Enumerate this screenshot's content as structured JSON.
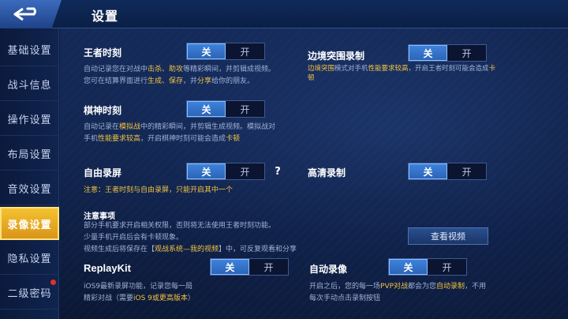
{
  "header": {
    "title": "设置"
  },
  "sidebar": {
    "items": [
      {
        "label": "基础设置"
      },
      {
        "label": "战斗信息"
      },
      {
        "label": "操作设置"
      },
      {
        "label": "布局设置"
      },
      {
        "label": "音效设置"
      },
      {
        "label": "录像设置",
        "active": true
      },
      {
        "label": "隐私设置"
      },
      {
        "label": "二级密码",
        "badge": "red-dot"
      }
    ]
  },
  "toggle_labels": {
    "off": "关",
    "on": "开"
  },
  "sections": {
    "king_moment": {
      "title": "王者时刻",
      "value": "关",
      "desc_line1_parts": [
        "自动记录您在对战中",
        "击杀、助攻",
        "等精彩瞬间，并剪辑成视频。"
      ],
      "desc_line2_parts": [
        "您可在结算界面进行",
        "生成、保存",
        "，并",
        "分享",
        "给你的朋友。"
      ]
    },
    "border_recording": {
      "title": "边境突围录制",
      "value": "关",
      "desc_line1_parts": [
        "边境突围",
        "模式对手机",
        "性能要求较高",
        "，开启王者时刻可能会造成",
        "卡"
      ],
      "desc_line2": "顿"
    },
    "chess_moment": {
      "title": "棋神时刻",
      "value": "关",
      "desc_line1_parts": [
        "自动记录在",
        "模拟战",
        "中的精彩瞬间，并剪辑生成视频。模拟战对"
      ],
      "desc_line2_parts": [
        "手机",
        "性能要求较高",
        "，开启棋神时刻可能会造成",
        "卡顿"
      ]
    },
    "free_record": {
      "title": "自由录屏",
      "value": "关",
      "help": "?",
      "note_parts": [
        "注意：王者时刻与自由录屏，",
        "只能开启其中一个"
      ]
    },
    "hd_record": {
      "title": "高清录制",
      "value": "关"
    },
    "notice": {
      "title": "注意事项",
      "line1": "部分手机要求开启相关权限，否则将无法使用王者时刻功能。",
      "line2": "少量手机开启后会有卡顿现象。",
      "line3_parts": [
        "视频生成后将保存在【",
        "观战系统—我的视频",
        "】中，可反复观看和分享"
      ],
      "button": "查看视频"
    },
    "replaykit": {
      "title": "ReplayKit",
      "value": "关",
      "line1": "iOS9最新录屏功能，记录您每一局",
      "line2_parts": [
        "精彩对战（需要",
        "iOS 9或更高版本",
        "）"
      ]
    },
    "auto_record": {
      "title": "自动录像",
      "value": "关",
      "line1_parts": [
        "开启之后，您的每一场",
        "PVP对战",
        "都会为您",
        "自动录制",
        "，不用"
      ],
      "line2": "每次手动点击录制按钮"
    }
  },
  "colors": {
    "accent_blue": "#3f84dc",
    "highlight_yellow": "#f1c341",
    "active_tab": "#f4c230",
    "background": "#10224a"
  }
}
